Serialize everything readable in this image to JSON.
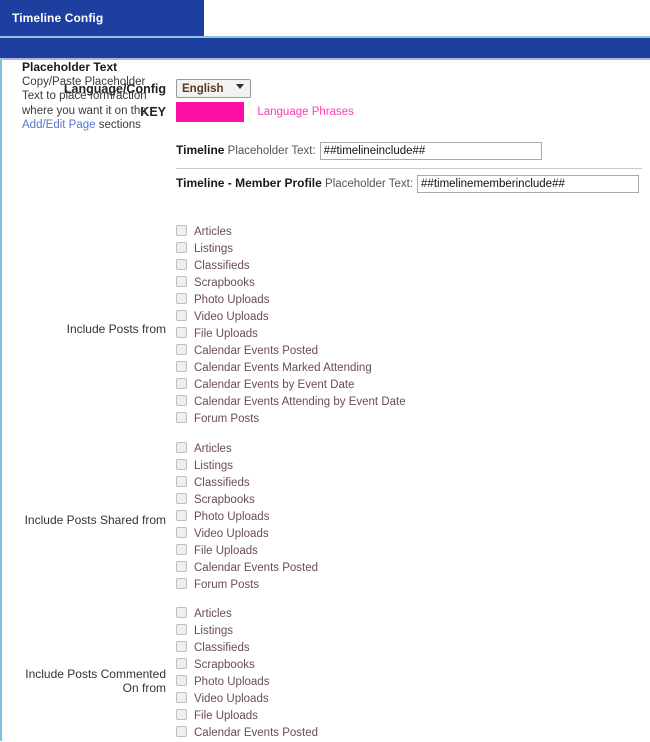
{
  "window": {
    "tab_label": "Timeline Config"
  },
  "form": {
    "language_label": "Language/Config",
    "language_selected": "English",
    "language_options": [
      "English"
    ],
    "key_label": "KEY",
    "key_value": "",
    "key_color": "#FF0FA5",
    "language_phrases_link": "Language Phrases"
  },
  "placeholder_section": {
    "title": "Placeholder Text",
    "description_line1": "Copy/Paste Placeholder",
    "description_line2": "Text to place form/action",
    "description_line3": "where you want it on the",
    "description_link": "Add/Edit Page",
    "description_line4_tail": " sections",
    "timeline_label_strong": "Timeline",
    "timeline_label_rest": " Placeholder Text:",
    "timeline_value": "##timelineinclude##",
    "member_label_strong": "Timeline - Member Profile",
    "member_label_rest": " Placeholder Text:",
    "member_value": "##timelinememberinclude##"
  },
  "groups": [
    {
      "label": "Include Posts from",
      "items": [
        "Articles",
        "Listings",
        "Classifieds",
        "Scrapbooks",
        "Photo Uploads",
        "Video Uploads",
        "File Uploads",
        "Calendar Events Posted",
        "Calendar Events Marked Attending",
        "Calendar Events by Event Date",
        "Calendar Events Attending by Event Date",
        "Forum Posts"
      ]
    },
    {
      "label": "Include Posts Shared from",
      "items": [
        "Articles",
        "Listings",
        "Classifieds",
        "Scrapbooks",
        "Photo Uploads",
        "Video Uploads",
        "File Uploads",
        "Calendar Events Posted",
        "Forum Posts"
      ]
    },
    {
      "label": "Include Posts Commented On from",
      "label_line1": "Include Posts Commented",
      "label_line2": "On from",
      "items": [
        "Articles",
        "Listings",
        "Classifieds",
        "Scrapbooks",
        "Photo Uploads",
        "Video Uploads",
        "File Uploads",
        "Calendar Events Posted"
      ]
    }
  ],
  "theme": {
    "tab_blue": "#1F3FA0",
    "accent_light_blue": "#7FC0DC",
    "link_blue": "#5577CC",
    "pink": "#FF3BB4"
  }
}
